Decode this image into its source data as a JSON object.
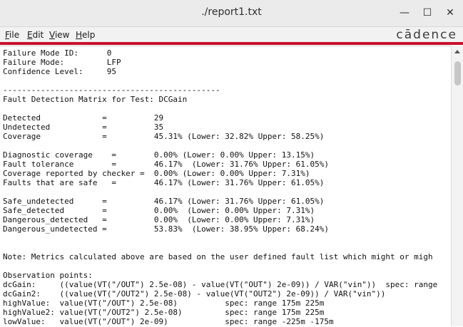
{
  "window": {
    "title": "./report1.txt",
    "minimize_glyph": "—",
    "maximize_glyph": "☐",
    "close_glyph": "✕"
  },
  "menu": {
    "file": {
      "u": "F",
      "rest": "ile"
    },
    "edit": {
      "u": "E",
      "rest": "dit"
    },
    "view": {
      "u": "V",
      "rest": "iew"
    },
    "help": {
      "u": "H",
      "rest": "elp"
    }
  },
  "brand": {
    "logo_text": "cādence"
  },
  "report": {
    "lines": [
      "Failure Mode ID:      0",
      "Failure Mode:         LFP",
      "Confidence Level:     95",
      "",
      "----------------------------------------------",
      "Fault Detection Matrix for Test: DCGain",
      "",
      "Detected             =          29",
      "Undetected           =          35",
      "Coverage             =          45.31% (Lower: 32.82% Upper: 58.25%)",
      "",
      "Diagnostic coverage    =        0.00% (Lower: 0.00% Upper: 13.15%)",
      "Fault tolerance        =        46.17%  (Lower: 31.76% Upper: 61.05%)",
      "Coverage reported by checker =  0.00% (Lower: 0.00% Upper: 7.31%)",
      "Faults that are safe   =        46.17% (Lower: 31.76% Upper: 61.05%)",
      "",
      "Safe_undetected      =          46.17% (Lower: 31.76% Upper: 61.05%)",
      "Safe_detected        =          0.00%  (Lower: 0.00% Upper: 7.31%)",
      "Dangerous_detected   =          0.00%  (Lower: 0.00% Upper: 7.31%)",
      "Dangerous_undetected =          53.83%  (Lower: 38.95% Upper: 68.24%)",
      "",
      "",
      "Note: Metrics calculated above are based on the user defined fault list which might or migh",
      "",
      "Observation points:",
      "dcGain:     ((value(VT(\"/OUT\") 2.5e-08) - value(VT(\"OUT\") 2e-09)) / VAR(\"vin\"))  spec: range",
      "dcGain2:    ((value(VT(\"/OUT2\") 2.5e-08) - value(VT(\"OUT2\") 2e-09)) / VAR(\"vin\"))",
      "highValue:  value(VT(\"/OUT\") 2.5e-08)          spec: range 175m 225m",
      "highValue2: value(VT(\"/OUT2\") 2.5e-08)         spec: range 175m 225m",
      "lowValue:   value(VT(\"/OUT\") 2e-09)            spec: range -225m -175m"
    ]
  }
}
